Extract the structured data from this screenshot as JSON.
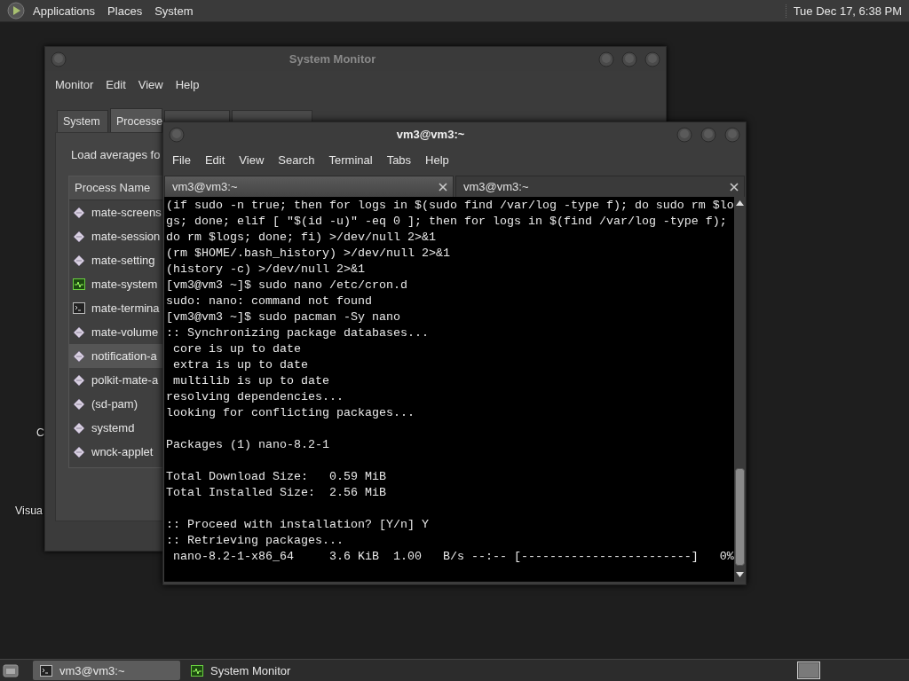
{
  "top_panel": {
    "menus": [
      "Applications",
      "Places",
      "System"
    ],
    "clock": "Tue Dec 17, 6:38 PM"
  },
  "desktop_icons": [
    {
      "label": "C"
    },
    {
      "label": "Visua"
    }
  ],
  "system_monitor": {
    "title": "System Monitor",
    "menus": [
      "Monitor",
      "Edit",
      "View",
      "Help"
    ],
    "tabs": [
      {
        "label": "System",
        "selected": false
      },
      {
        "label": "Processe",
        "selected": true
      },
      {
        "selected": false
      },
      {
        "selected": false
      }
    ],
    "load_averages": "Load averages fo",
    "process_table": {
      "columns": [
        "Process Name"
      ],
      "rows": [
        {
          "name": "mate-screens",
          "kind": "diamond",
          "selected": false
        },
        {
          "name": "mate-session",
          "kind": "diamond",
          "selected": false
        },
        {
          "name": "mate-setting",
          "kind": "diamond",
          "selected": false
        },
        {
          "name": "mate-system",
          "kind": "monitor",
          "selected": false
        },
        {
          "name": "mate-termina",
          "kind": "terminal",
          "selected": false
        },
        {
          "name": "mate-volume",
          "kind": "diamond",
          "selected": false
        },
        {
          "name": "notification-a",
          "kind": "diamond",
          "selected": true
        },
        {
          "name": "polkit-mate-a",
          "kind": "diamond",
          "selected": false
        },
        {
          "name": "(sd-pam)",
          "kind": "diamond",
          "selected": false
        },
        {
          "name": "systemd",
          "kind": "diamond",
          "selected": false
        },
        {
          "name": "wnck-applet",
          "kind": "diamond",
          "selected": false
        }
      ]
    }
  },
  "terminal": {
    "title": "vm3@vm3:~",
    "menus": [
      "File",
      "Edit",
      "View",
      "Search",
      "Terminal",
      "Tabs",
      "Help"
    ],
    "tabs": [
      {
        "label": "vm3@vm3:~",
        "selected": true
      },
      {
        "label": "vm3@vm3:~",
        "selected": false
      }
    ],
    "blocks": [
      [
        "(if sudo -n true; then for logs in $(sudo find /var/log -type f); do sudo rm $lo",
        "gs; done; elif [ \"$(id -u)\" -eq 0 ]; then for logs in $(find /var/log -type f);",
        "do rm $logs; done; fi) >/dev/null 2>&1",
        "(rm $HOME/.bash_history) >/dev/null 2>&1",
        "(history -c) >/dev/null 2>&1",
        "[vm3@vm3 ~]$ sudo nano /etc/cron.d",
        "sudo: nano: command not found",
        "[vm3@vm3 ~]$ sudo pacman -Sy nano",
        ":: Synchronizing package databases...",
        " core is up to date",
        " extra is up to date",
        " multilib is up to date",
        "resolving dependencies...",
        "looking for conflicting packages..."
      ],
      [
        "Packages (1) nano-8.2-1"
      ],
      [
        "Total Download Size:   0.59 MiB",
        "Total Installed Size:  2.56 MiB"
      ],
      [
        ":: Proceed with installation? [Y/n] Y",
        ":: Retrieving packages...",
        " nano-8.2-1-x86_64     3.6 KiB  1.00   B/s --:-- [------------------------]   0%"
      ]
    ]
  },
  "taskbar": {
    "buttons": [
      {
        "label": "vm3@vm3:~",
        "kind": "terminal",
        "selected": true
      },
      {
        "label": "System Monitor",
        "kind": "monitor",
        "selected": false
      }
    ]
  }
}
